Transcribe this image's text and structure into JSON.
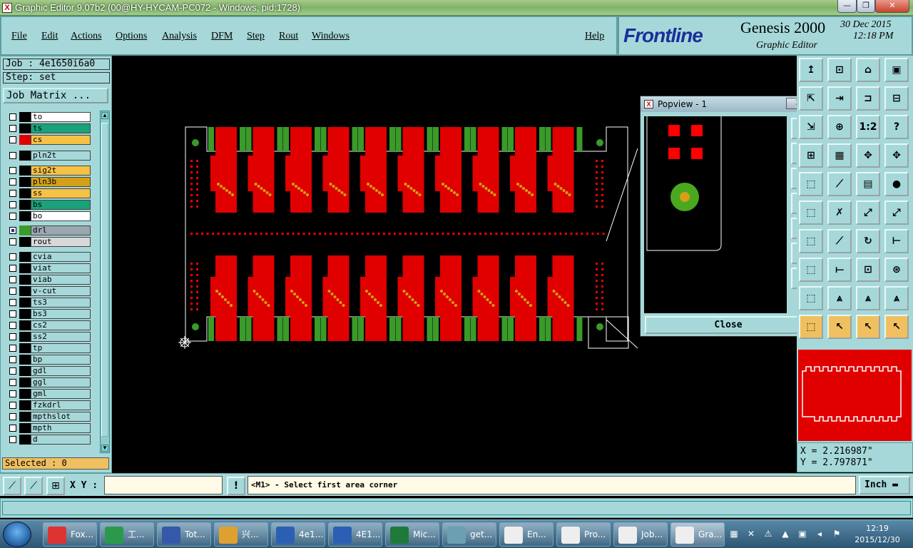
{
  "window": {
    "title": "Graphic Editor 9.07b2 (00@HY-HYCAM-PC072 - Windows, pid:1728)",
    "app_icon": "X",
    "buttons": [
      "minimize",
      "maximize",
      "close"
    ],
    "button_glyphs": [
      "—",
      "❐",
      "✕"
    ]
  },
  "menu": {
    "items": [
      "File",
      "Edit",
      "Actions",
      "Options",
      "Analysis",
      "DFM",
      "Step",
      "Rout",
      "Windows"
    ],
    "help": "Help"
  },
  "brand": {
    "logo": "Frontline",
    "product": "Genesis 2000",
    "subtitle": "Graphic Editor",
    "date": "30 Dec 2015",
    "time": "12:18 PM"
  },
  "left": {
    "job": "Job : 4e1650i6a0",
    "step": "Step: set",
    "job_matrix": "Job Matrix ...",
    "selected": "Selected : 0",
    "layers": [
      {
        "name": "to",
        "color": "#ffffff",
        "swatch": "#000000"
      },
      {
        "name": "ts",
        "color": "#1aa37a",
        "swatch": "#000000"
      },
      {
        "name": "cs",
        "color": "#f5c246",
        "swatch": "#e00000"
      },
      {
        "name": "pln2t",
        "color": "#a6d8d9",
        "swatch": "#000000"
      },
      {
        "name": "sig2t",
        "color": "#f5c246",
        "swatch": "#000000"
      },
      {
        "name": "pln3b",
        "color": "#d4a017",
        "swatch": "#000000"
      },
      {
        "name": "ss",
        "color": "#f5c246",
        "swatch": "#000000"
      },
      {
        "name": "bs",
        "color": "#1aa37a",
        "swatch": "#000000"
      },
      {
        "name": "bo",
        "color": "#ffffff",
        "swatch": "#000000"
      },
      {
        "name": "drl",
        "color": "#9aa7b0",
        "swatch": "#3a9a2a",
        "checked": true
      },
      {
        "name": "rout",
        "color": "#d8d8d8",
        "swatch": "#000000"
      },
      {
        "name": "cvia",
        "color": "#a6d8d9",
        "swatch": "#000000"
      },
      {
        "name": "viat",
        "color": "#a6d8d9",
        "swatch": "#000000"
      },
      {
        "name": "viab",
        "color": "#a6d8d9",
        "swatch": "#000000"
      },
      {
        "name": "v-cut",
        "color": "#a6d8d9",
        "swatch": "#000000"
      },
      {
        "name": "ts3",
        "color": "#a6d8d9",
        "swatch": "#000000"
      },
      {
        "name": "bs3",
        "color": "#a6d8d9",
        "swatch": "#000000"
      },
      {
        "name": "cs2",
        "color": "#a6d8d9",
        "swatch": "#000000"
      },
      {
        "name": "ss2",
        "color": "#a6d8d9",
        "swatch": "#000000"
      },
      {
        "name": "tp",
        "color": "#a6d8d9",
        "swatch": "#000000"
      },
      {
        "name": "bp",
        "color": "#a6d8d9",
        "swatch": "#000000"
      },
      {
        "name": "gdl",
        "color": "#a6d8d9",
        "swatch": "#000000"
      },
      {
        "name": "ggl",
        "color": "#a6d8d9",
        "swatch": "#000000"
      },
      {
        "name": "gml",
        "color": "#a6d8d9",
        "swatch": "#000000"
      },
      {
        "name": "fzkdrl",
        "color": "#a6d8d9",
        "swatch": "#000000"
      },
      {
        "name": "mpthslot",
        "color": "#a6d8d9",
        "swatch": "#000000"
      },
      {
        "name": "mpth",
        "color": "#a6d8d9",
        "swatch": "#000000"
      },
      {
        "name": "d",
        "color": "#a6d8d9",
        "swatch": "#000000"
      }
    ]
  },
  "popview": {
    "title": "Popview - 1",
    "close_glyph": "✕",
    "close_label": "Close"
  },
  "toolbar": {
    "glyphs": [
      "↥",
      "⊡",
      "⌂",
      "▣",
      "⇱",
      "⇥",
      "⊐",
      "⊟",
      "⇲",
      "⊕",
      "1:2",
      "?",
      "⊞",
      "▦",
      "✥",
      "✥",
      "⬚",
      "⟋",
      "▤",
      "●",
      "⬚",
      "✗",
      "⤢",
      "⤢",
      "⬚",
      "⟋",
      "↻",
      "⊢",
      "⬚",
      "⟝",
      "⊡",
      "⊛",
      "⬚",
      "⩓",
      "⩓",
      "⩓",
      "⬚",
      "↖",
      "↖",
      "↖"
    ],
    "side_glyphs": [
      "⊡",
      "⊡",
      "⊡",
      "⊡",
      "⊡",
      "⊞",
      "⊞"
    ]
  },
  "coords": {
    "x": "X = 2.216987\"",
    "y": "Y = 2.797871\""
  },
  "bottom": {
    "xy_label": "X Y :",
    "xy_value": "",
    "alert": "!",
    "message": "<M1> - Select first area corner",
    "unit": "Inch ▬",
    "tool_glyphs": [
      "⟋",
      "⟋",
      "⊞"
    ]
  },
  "taskbar": {
    "items": [
      {
        "label": "Fox...",
        "color": "#d33"
      },
      {
        "label": "工...",
        "color": "#2a9a4a"
      },
      {
        "label": "Tot...",
        "color": "#3558a8"
      },
      {
        "label": "兴...",
        "color": "#e0a030"
      },
      {
        "label": "4e1...",
        "color": "#2b5fb4"
      },
      {
        "label": "4E1...",
        "color": "#2b5fb4"
      },
      {
        "label": "Mic...",
        "color": "#1e7a3a"
      },
      {
        "label": "get...",
        "color": "#6aa0b0"
      },
      {
        "label": "En...",
        "color": "#eee"
      },
      {
        "label": "Pro...",
        "color": "#eee"
      },
      {
        "label": "Job...",
        "color": "#eee"
      },
      {
        "label": "Gra...",
        "color": "#eee"
      }
    ],
    "tray_glyphs": [
      "▦",
      "✕",
      "⚠",
      "▲",
      "▣",
      "◂",
      "⚑"
    ],
    "clock_time": "12:19",
    "clock_date": "2015/12/30"
  },
  "colors": {
    "accent": "#a6d8d9",
    "copper": "#e00000",
    "drill": "#3a9a2a"
  }
}
